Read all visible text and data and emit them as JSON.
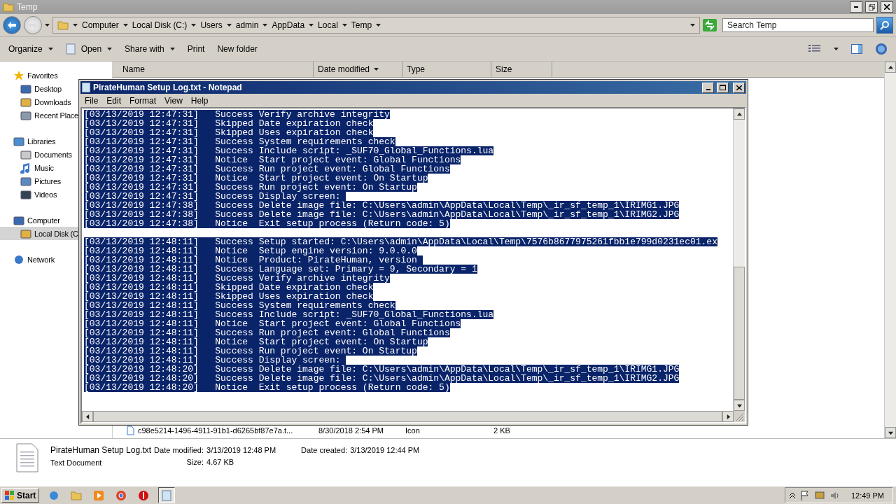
{
  "explorer": {
    "title": "Temp",
    "address": [
      "Computer",
      "Local Disk (C:)",
      "Users",
      "admin",
      "AppData",
      "Local",
      "Temp"
    ],
    "search": {
      "placeholder": "Search Temp"
    },
    "toolbar": [
      {
        "label": "Organize",
        "dropdown": true
      },
      {
        "label": "Open",
        "dropdown": true
      },
      {
        "label": "Share with",
        "dropdown": true
      },
      {
        "label": "Print",
        "dropdown": false
      },
      {
        "label": "New folder",
        "dropdown": false
      }
    ],
    "columns": [
      "Name",
      "Date modified",
      "Type",
      "Size"
    ],
    "sidebar": [
      {
        "label": "Favorites",
        "selected": false,
        "children": [
          {
            "label": "Desktop",
            "selected": false
          },
          {
            "label": "Downloads",
            "selected": false
          },
          {
            "label": "Recent Place",
            "selected": false
          }
        ]
      },
      {
        "label": "Libraries",
        "selected": false,
        "children": [
          {
            "label": "Documents",
            "selected": false
          },
          {
            "label": "Music",
            "selected": false
          },
          {
            "label": "Pictures",
            "selected": false
          },
          {
            "label": "Videos",
            "selected": false
          }
        ]
      },
      {
        "label": "Computer",
        "selected": false,
        "children": [
          {
            "label": "Local Disk (C",
            "selected": true
          }
        ]
      },
      {
        "label": "Network",
        "selected": false
      }
    ],
    "files": [
      {
        "name": "c98e5214-1496-4911-91b1-d6265bf87e7a.t...",
        "date": "8/30/2018 2:54 PM",
        "type": "Icon",
        "size": "2 KB"
      }
    ],
    "details": {
      "name": "PirateHuman Setup Log.txt",
      "type": "Text Document",
      "fields": [
        {
          "label": "Date modified:",
          "value": "3/13/2019 12:48 PM"
        },
        {
          "label": "Date created:",
          "value": "3/13/2019 12:44 PM"
        },
        {
          "label": "Size:",
          "value": "4.67 KB"
        }
      ]
    }
  },
  "notepad": {
    "title": "PirateHuman Setup Log.txt - Notepad",
    "menu": [
      "File",
      "Edit",
      "Format",
      "View",
      "Help"
    ],
    "text_selected": true,
    "blocks": [
      {
        "lines": [
          "[03/13/2019 12:47:31]\tSuccess\tVerify archive integrity",
          "[03/13/2019 12:47:31]\tSkipped\tDate expiration check",
          "[03/13/2019 12:47:31]\tSkipped\tUses expiration check",
          "[03/13/2019 12:47:31]\tSuccess\tSystem requirements check",
          "[03/13/2019 12:47:31]\tSuccess\tInclude script: _SUF70_Global_Functions.lua",
          "[03/13/2019 12:47:31]\tNotice\tStart project event: Global Functions",
          "[03/13/2019 12:47:31]\tSuccess\tRun project event: Global Functions",
          "[03/13/2019 12:47:31]\tNotice\tStart project event: On Startup",
          "[03/13/2019 12:47:31]\tSuccess\tRun project event: On Startup",
          "[03/13/2019 12:47:31]\tSuccess\tDisplay screen: ",
          "[03/13/2019 12:47:38]\tSuccess\tDelete image file: C:\\Users\\admin\\AppData\\Local\\Temp\\_ir_sf_temp_1\\IRIMG1.JPG",
          "[03/13/2019 12:47:38]\tSuccess\tDelete image file: C:\\Users\\admin\\AppData\\Local\\Temp\\_ir_sf_temp_1\\IRIMG2.JPG",
          "[03/13/2019 12:47:38]\tNotice\tExit setup process (Return code: 5)"
        ]
      },
      {
        "lines": [
          "[03/13/2019 12:48:11]\tSuccess\tSetup started: C:\\Users\\admin\\AppData\\Local\\Temp\\7576b8677975261fbb1e799d0231ec01.ex",
          "[03/13/2019 12:48:11]\tNotice\tSetup engine version: 9.0.0.0",
          "[03/13/2019 12:48:11]\tNotice\tProduct: PirateHuman, version ",
          "[03/13/2019 12:48:11]\tSuccess\tLanguage set: Primary = 9, Secondary = 1",
          "[03/13/2019 12:48:11]\tSuccess\tVerify archive integrity",
          "[03/13/2019 12:48:11]\tSkipped\tDate expiration check",
          "[03/13/2019 12:48:11]\tSkipped\tUses expiration check",
          "[03/13/2019 12:48:11]\tSuccess\tSystem requirements check",
          "[03/13/2019 12:48:11]\tSuccess\tInclude script: _SUF70_Global_Functions.lua",
          "[03/13/2019 12:48:11]\tNotice\tStart project event: Global Functions",
          "[03/13/2019 12:48:11]\tSuccess\tRun project event: Global Functions",
          "[03/13/2019 12:48:11]\tNotice\tStart project event: On Startup",
          "[03/13/2019 12:48:11]\tSuccess\tRun project event: On Startup",
          "[03/13/2019 12:48:11]\tSuccess\tDisplay screen: ",
          "[03/13/2019 12:48:20]\tSuccess\tDelete image file: C:\\Users\\admin\\AppData\\Local\\Temp\\_ir_sf_temp_1\\IRIMG1.JPG",
          "[03/13/2019 12:48:20]\tSuccess\tDelete image file: C:\\Users\\admin\\AppData\\Local\\Temp\\_ir_sf_temp_1\\IRIMG2.JPG",
          "[03/13/2019 12:48:20]\tNotice\tExit setup process (Return code: 5)"
        ]
      }
    ]
  },
  "taskbar": {
    "start": "Start",
    "clock": "12:49 PM"
  }
}
